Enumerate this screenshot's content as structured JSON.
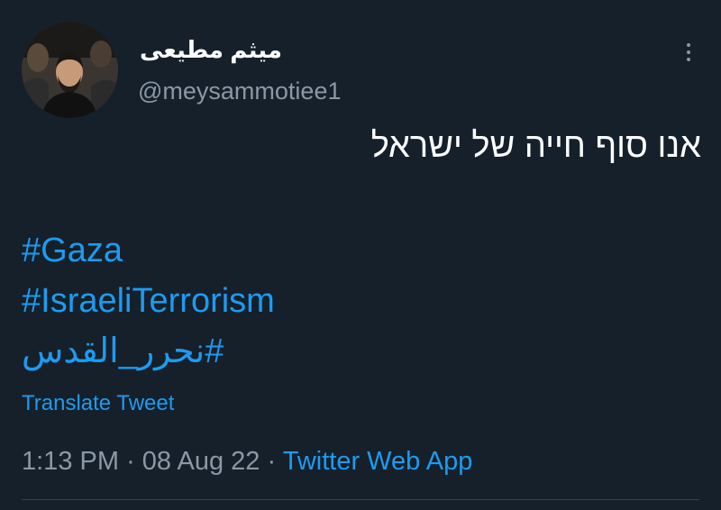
{
  "tweet": {
    "author": {
      "display_name": "میثم مطیعی",
      "handle": "@meysammotiee1"
    },
    "text": "אנו סוף חייה של ישראל",
    "hashtags": [
      "#Gaza",
      "#IsraeliTerrorism",
      "#نحرر_القدس"
    ],
    "translate_label": "Translate Tweet",
    "time": "1:13 PM",
    "separator": "·",
    "date": "08 Aug 22",
    "source": "Twitter Web App"
  },
  "colors": {
    "background": "#15202b",
    "text_primary": "#ffffff",
    "text_secondary": "#8b98a5",
    "accent": "#1d9bf0",
    "divider": "#38444d"
  },
  "icons": {
    "more": "vertical-ellipsis-icon"
  }
}
